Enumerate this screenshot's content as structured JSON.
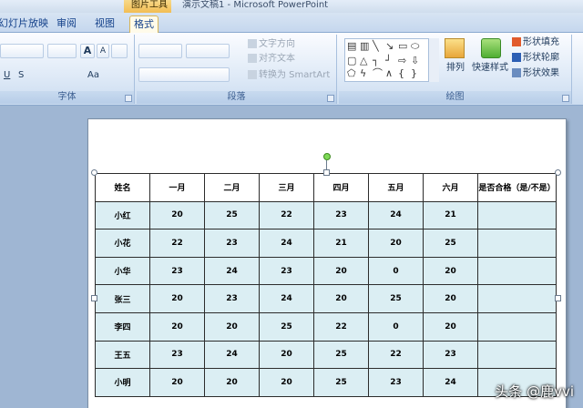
{
  "window": {
    "title": "演示文稿1 - Microsoft PowerPoint",
    "context_tab_group": "图片工具"
  },
  "tabs": [
    {
      "label": "幻灯片放映",
      "active": false
    },
    {
      "label": "审阅",
      "active": false
    },
    {
      "label": "视图",
      "active": false
    },
    {
      "label": "格式",
      "active": true
    }
  ],
  "ribbon": {
    "font_group": {
      "label": "字体",
      "grow": "A",
      "shrink": "A",
      "change_case": "Aa",
      "underline": "U",
      "shadow": "S"
    },
    "paragraph_group": {
      "label": "段落",
      "text_direction": "文字方向",
      "align_text": "对齐文本",
      "convert_smartart": "转换为 SmartArt"
    },
    "drawing_group": {
      "label": "绘图",
      "arrange": "排列",
      "quick_styles": "快速样式",
      "shape_fill": "形状填充",
      "shape_outline": "形状轮廓",
      "shape_effects": "形状效果"
    }
  },
  "table": {
    "headers": [
      "姓名",
      "一月",
      "二月",
      "三月",
      "四月",
      "五月",
      "六月",
      "是否合格（是/不是）"
    ],
    "rows": [
      [
        "小红",
        "20",
        "25",
        "22",
        "23",
        "24",
        "21",
        ""
      ],
      [
        "小花",
        "22",
        "23",
        "24",
        "21",
        "20",
        "25",
        ""
      ],
      [
        "小华",
        "23",
        "24",
        "23",
        "20",
        "0",
        "20",
        ""
      ],
      [
        "张三",
        "20",
        "23",
        "24",
        "20",
        "25",
        "20",
        ""
      ],
      [
        "李四",
        "20",
        "20",
        "25",
        "22",
        "0",
        "20",
        ""
      ],
      [
        "王五",
        "23",
        "24",
        "20",
        "25",
        "22",
        "23",
        ""
      ],
      [
        "小明",
        "20",
        "20",
        "20",
        "25",
        "23",
        "24",
        ""
      ]
    ]
  },
  "watermark": "头条 @鹿vvi"
}
